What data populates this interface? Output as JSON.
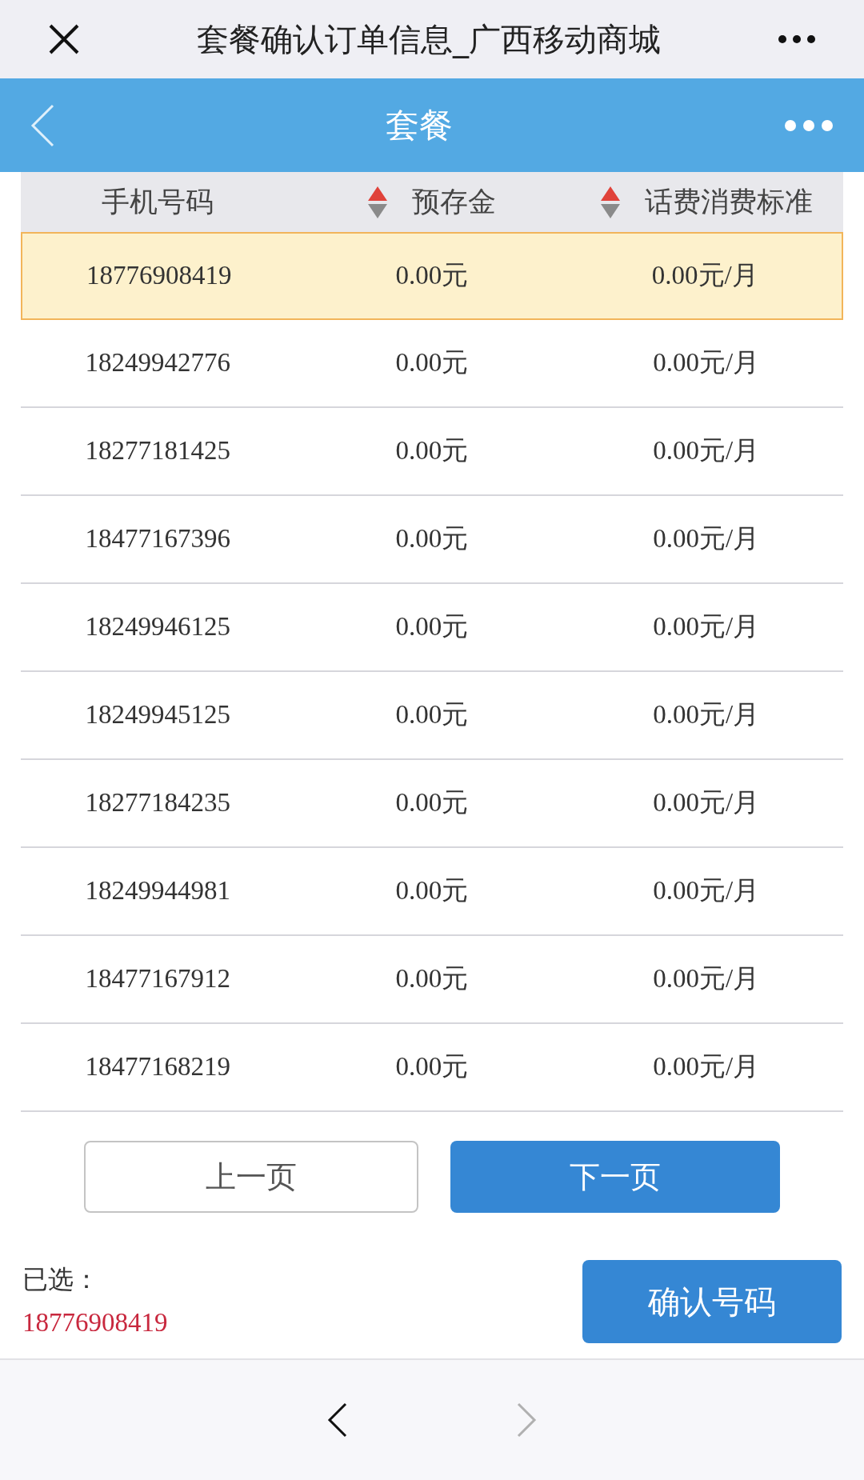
{
  "browser_bar": {
    "title": "套餐确认订单信息_广西移动商城"
  },
  "app_bar": {
    "title": "套餐"
  },
  "table": {
    "columns": [
      {
        "label": "手机号码",
        "sortable": false
      },
      {
        "label": "预存金",
        "sortable": true
      },
      {
        "label": "话费消费标准",
        "sortable": true
      }
    ],
    "rows": [
      {
        "cells": [
          "18776908419",
          "0.00元",
          "0.00元/月"
        ],
        "selected": true
      },
      {
        "cells": [
          "18249942776",
          "0.00元",
          "0.00元/月"
        ],
        "selected": false
      },
      {
        "cells": [
          "18277181425",
          "0.00元",
          "0.00元/月"
        ],
        "selected": false
      },
      {
        "cells": [
          "18477167396",
          "0.00元",
          "0.00元/月"
        ],
        "selected": false
      },
      {
        "cells": [
          "18249946125",
          "0.00元",
          "0.00元/月"
        ],
        "selected": false
      },
      {
        "cells": [
          "18249945125",
          "0.00元",
          "0.00元/月"
        ],
        "selected": false
      },
      {
        "cells": [
          "18277184235",
          "0.00元",
          "0.00元/月"
        ],
        "selected": false
      },
      {
        "cells": [
          "18249944981",
          "0.00元",
          "0.00元/月"
        ],
        "selected": false
      },
      {
        "cells": [
          "18477167912",
          "0.00元",
          "0.00元/月"
        ],
        "selected": false
      },
      {
        "cells": [
          "18477168219",
          "0.00元",
          "0.00元/月"
        ],
        "selected": false
      }
    ]
  },
  "pager": {
    "prev": "上一页",
    "next": "下一页"
  },
  "selection": {
    "label": "已选：",
    "value": "18776908419",
    "confirm": "确认号码"
  },
  "nav": {
    "back_disabled": false,
    "forward_disabled": true
  }
}
